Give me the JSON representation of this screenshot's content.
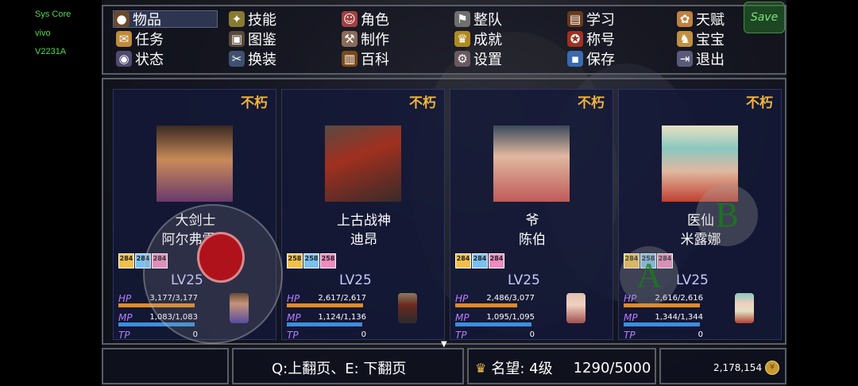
{
  "system": {
    "lines": [
      "Sys Core",
      "vivo",
      "V2231A"
    ]
  },
  "menu": {
    "items": [
      {
        "label": "物品",
        "icon": "bag-icon",
        "selected": true
      },
      {
        "label": "技能",
        "icon": "skill-icon"
      },
      {
        "label": "角色",
        "icon": "mask-icon"
      },
      {
        "label": "整队",
        "icon": "team-icon"
      },
      {
        "label": "学习",
        "icon": "book-icon"
      },
      {
        "label": "天赋",
        "icon": "talent-icon"
      },
      {
        "label": "任务",
        "icon": "quest-icon"
      },
      {
        "label": "图鉴",
        "icon": "codex-icon"
      },
      {
        "label": "制作",
        "icon": "craft-icon"
      },
      {
        "label": "成就",
        "icon": "trophy-icon"
      },
      {
        "label": "称号",
        "icon": "medal-icon"
      },
      {
        "label": "宝宝",
        "icon": "pet-icon"
      },
      {
        "label": "状态",
        "icon": "status-icon"
      },
      {
        "label": "换装",
        "icon": "outfit-icon"
      },
      {
        "label": "百科",
        "icon": "encyclopedia-icon"
      },
      {
        "label": "设置",
        "icon": "gear-icon"
      },
      {
        "label": "保存",
        "icon": "save-disk-icon"
      },
      {
        "label": "退出",
        "icon": "exit-icon"
      }
    ],
    "save_button": "Save"
  },
  "party": [
    {
      "status": "不朽",
      "class": "大剑士",
      "name": "阿尔弗雷德",
      "badges": [
        "284",
        "284",
        "284"
      ],
      "level": "LV25",
      "hp": "3,177/3,177",
      "mp": "1,083/1,083",
      "tp": "0",
      "hp_fill": 1.0,
      "mp_fill": 1.0
    },
    {
      "status": "不朽",
      "class": "上古战神",
      "name": "迪昂",
      "badges": [
        "258",
        "258",
        "258"
      ],
      "level": "LV25",
      "hp": "2,617/2,617",
      "mp": "1,124/1,136",
      "tp": "0",
      "hp_fill": 1.0,
      "mp_fill": 0.99
    },
    {
      "status": "不朽",
      "class": "爷",
      "name": "陈伯",
      "badges": [
        "284",
        "284",
        "284"
      ],
      "level": "LV25",
      "hp": "2,486/3,077",
      "mp": "1,095/1,095",
      "tp": "0",
      "hp_fill": 0.81,
      "mp_fill": 1.0
    },
    {
      "status": "不朽",
      "class": "医仙",
      "name": "米露娜",
      "badges": [
        "284",
        "258",
        "284"
      ],
      "level": "LV25",
      "hp": "2,616/2,616",
      "mp": "1,344/1,344",
      "tp": "0",
      "hp_fill": 1.0,
      "mp_fill": 1.0
    }
  ],
  "labels": {
    "hp": "HP",
    "mp": "MP",
    "tp": "TP"
  },
  "bottom": {
    "hint": "Q:上翻页、E: 下翻页",
    "reputation_label": "名望: 4级",
    "reputation_value": "1290/5000",
    "gold": "2,178,154"
  },
  "controls": {
    "a": "A",
    "b": "B"
  },
  "colors": {
    "immortal": "#f2b33c",
    "hp_bar": "#e08a2a",
    "mp_bar": "#3b8fe0",
    "accent_border": "#5a5d6a"
  }
}
